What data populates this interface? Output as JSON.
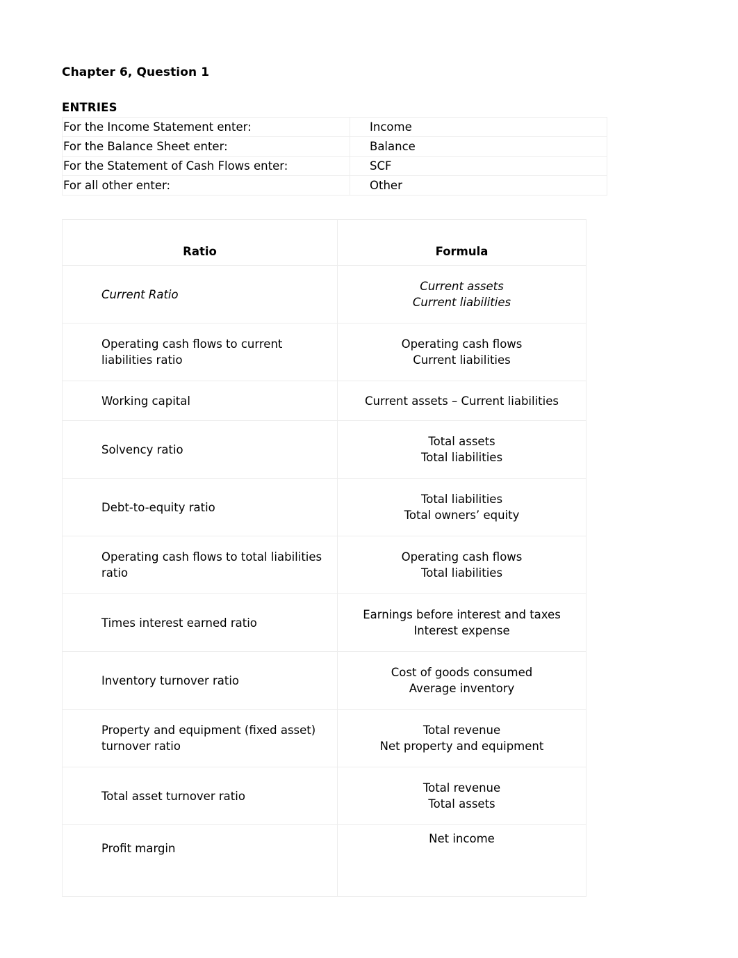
{
  "document": {
    "title": "Chapter 6, Question 1",
    "section_label": "ENTRIES"
  },
  "entries_table": {
    "rows": [
      {
        "prompt": "For the Income Statement enter:",
        "answer": "Income"
      },
      {
        "prompt": "For the Balance Sheet enter:",
        "answer": "Balance"
      },
      {
        "prompt": "For the Statement of Cash Flows enter:",
        "answer": "SCF"
      },
      {
        "prompt": "For all other enter:",
        "answer": "Other"
      }
    ]
  },
  "ratio_table": {
    "headers": {
      "ratio": "Ratio",
      "formula": "Formula"
    },
    "rows": [
      {
        "ratio": "Current Ratio",
        "italic": true,
        "numerator": "Current assets",
        "denominator": "Current liabilities"
      },
      {
        "ratio": "Operating cash flows to current liabilities ratio",
        "italic": false,
        "numerator": "Operating cash flows",
        "denominator": "Current liabilities"
      },
      {
        "ratio": "Working capital",
        "italic": false,
        "numerator": "Current assets – Current liabilities",
        "denominator": ""
      },
      {
        "ratio": "Solvency ratio",
        "italic": false,
        "numerator": "Total assets",
        "denominator": "Total liabilities"
      },
      {
        "ratio": "Debt-to-equity ratio",
        "italic": false,
        "numerator": "Total liabilities",
        "denominator": "Total owners’ equity"
      },
      {
        "ratio": "Operating cash flows to total liabilities ratio",
        "italic": false,
        "numerator": "Operating cash flows",
        "denominator": "Total liabilities"
      },
      {
        "ratio": "Times interest earned ratio",
        "italic": false,
        "numerator": "Earnings before interest and taxes",
        "denominator": "Interest expense"
      },
      {
        "ratio": "Inventory turnover ratio",
        "italic": false,
        "numerator": "Cost of goods consumed",
        "denominator": "Average inventory"
      },
      {
        "ratio": "Property and equipment (fixed asset) turnover ratio",
        "italic": false,
        "numerator": "Total revenue",
        "denominator": "Net property and equipment"
      },
      {
        "ratio": "Total asset turnover ratio",
        "italic": false,
        "numerator": "Total revenue",
        "denominator": "Total assets"
      },
      {
        "ratio": "Profit margin",
        "italic": false,
        "numerator": "Net income",
        "denominator": ""
      }
    ]
  }
}
